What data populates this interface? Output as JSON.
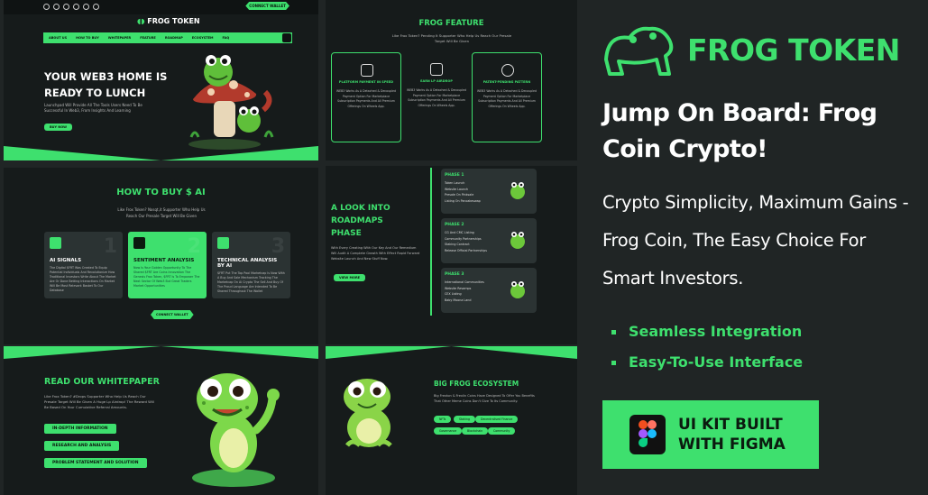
{
  "left": {
    "hero": {
      "logo_text": "FROG TOKEN",
      "cta_top": "CONNECT WALLET",
      "nav": [
        "ABOUT US",
        "HOW TO BUY",
        "WHITEPAPER",
        "FEATURE",
        "ROADMAP",
        "ECOSYSTEM",
        "FAQ"
      ],
      "title": "YOUR WEB3 HOME IS READY TO LUNCH",
      "subtitle": "Launchpad Will Provide All The Tools Users Need To Be Successful In Web3, From Insights And Learning",
      "button": "BUY NOW"
    },
    "how_to_buy": {
      "title": "HOW TO BUY $ AI",
      "desc": "Like Frox Token? Nosqt,it Supporter Who Help Us Reach Our Presale Target Will Be Given",
      "cards": [
        {
          "title": "AI SIGNALS",
          "num": "1",
          "text": "The Digital $FRT Was Created To Equip Potential Individuals And Revolutionize How Traditional Investors Write About The Market Are Or Done Betting Interactions On Market Will Be Most Relevant Basket To Our Database"
        },
        {
          "title": "SENTIMENT ANALYSIS",
          "num": "2",
          "text": "Now Is Your Golden Opportunity To The Shared $FRT Are Coins Innovation The Genesis Frox Token, $FRT Is To Empower The Next Sector Of Web3 But Great Traders Market Opportunities"
        },
        {
          "title": "TECHNICAL ANALYSIS BY AI",
          "num": "3",
          "text": "$FRT Put The Top Pool Marketcap Is Now With A Buy And Sale Mechanism Tracking The Marketcap On Ai Crypto The Sell And Buy Of The Proud Language Are Intended To Be Shared Throughout The Wallet"
        }
      ],
      "cta": "CONNECT WALLET"
    },
    "whitepaper": {
      "title": "READ OUR WHITEPAPER",
      "desc": "Like Frox Token? #Drops Supporter Who Help Us Reach Our Presale Target Will Be Given A Huge Lp Airdrop! The Reward Will Be Based On Your Cumulative Referral Amounts.",
      "pills": [
        "IN-DEPTH INFORMATION",
        "RESEARCH AND ANALYSIS",
        "PROBLEM STATEMENT AND SOLUTION"
      ]
    },
    "feature": {
      "title": "FROG FEATURE",
      "desc": "Like Frox Token? Pending It Supporter Who Help Us Reach Our Presale Target Will Be Given",
      "items": [
        {
          "title": "PLATFORM PAYMENT IN SPEED",
          "text": "WEB3 Works As A Detached & Decoupled Payment Option For Marketplace Subscription Payments And All Premium Offerings On Wheels App."
        },
        {
          "title": "EARN LP AIRDROP",
          "text": "WEB3 Works As A Detached & Decoupled Payment Option For Marketplace Subscription Payments And All Premium Offerings On Wheels App."
        },
        {
          "title": "PATENT-PENDING PATTERN",
          "text": "WEB3 Works As A Detached & Decoupled Payment Option For Marketplace Subscription Payments And All Premium Offerings On Wheels App."
        }
      ]
    },
    "roadmap": {
      "title": "A LOOK INTO ROADMAPS PHASE",
      "desc": "With Every Creating With Our Key And Our Remedium Will Audit A Complete Growth With Effect Rapid Forward Website Launch And New Stuff Now.",
      "button": "VIEW MORE",
      "phases": [
        {
          "title": "PHASE 1",
          "items": [
            "Token Launch",
            "Website Launch",
            "Presale On Pinksale",
            "Listing On Pancakeswap"
          ]
        },
        {
          "title": "PHASE 2",
          "items": [
            "CG And CMC Listing",
            "Community Partnerships",
            "Staking Contract",
            "Release Official Partnerships"
          ]
        },
        {
          "title": "PHASE 3",
          "items": [
            "International Communities",
            "Website Revamps",
            "CEX Listing",
            "Baby Moona Land"
          ]
        }
      ]
    },
    "ecosystem": {
      "title": "BIG FROG ECOSYSTEM",
      "desc": "Big Frexton & Frexlin Coins Have Designed To Offer You Benefits That Other Meme Coins Don't Give To Its Community.",
      "tags": [
        "NFTs",
        "Staking",
        "Decentralised Finance",
        "Governance",
        "Blockchain",
        "Community"
      ]
    }
  },
  "right": {
    "brand": "FROG TOKEN",
    "title": "Jump On Board: Frog Coin Crypto!",
    "subtitle": "Crypto Simplicity, Maximum Gains - Frog Coin, The Easy Choice For Smart Investors.",
    "bullets": [
      "Seamless Integration",
      "Easy-To-Use Interface"
    ],
    "figma_box": "UI KIT BUILT WITH FIGMA"
  },
  "colors": {
    "accent": "#3ee06e",
    "bg": "#202525",
    "panel": "#161b1b"
  }
}
